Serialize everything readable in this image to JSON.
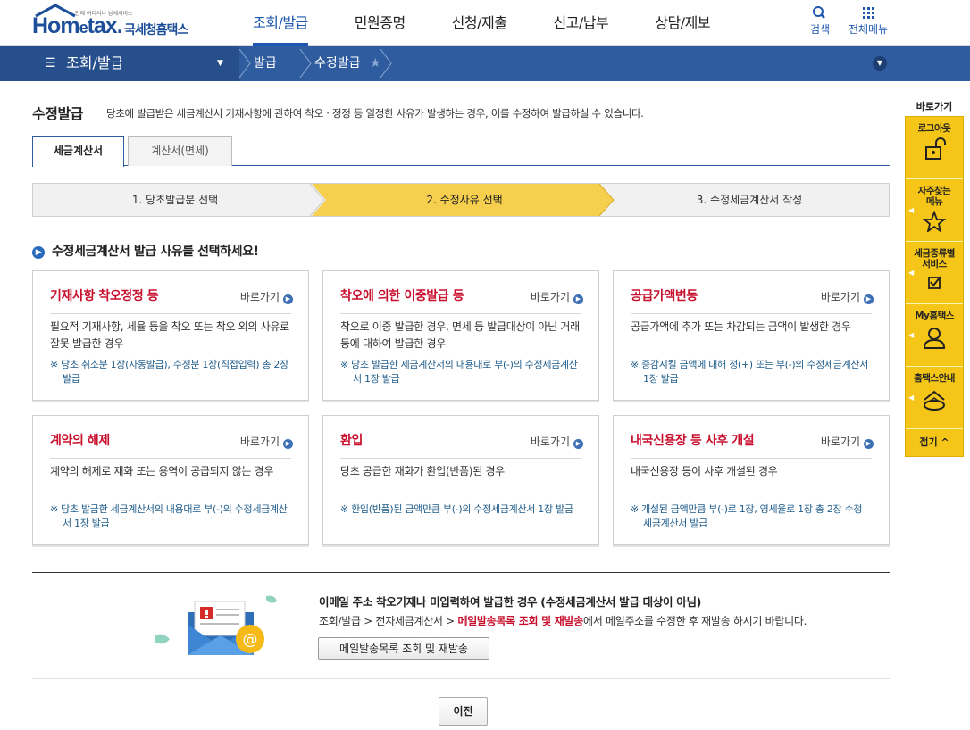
{
  "header": {
    "logo_sub": "언제 어디서나 납세서비스",
    "logo_word_1": "Hom",
    "logo_word_e": "e",
    "logo_word_2": "tax.",
    "logo_kor": "국세청홈택스",
    "nav": [
      "조회/발급",
      "민원증명",
      "신청/제출",
      "신고/납부",
      "상담/제보"
    ],
    "active_nav": "조회/발급",
    "search_label": "검색",
    "menu_label": "전체메뉴"
  },
  "location": {
    "main": "조회/발급",
    "crumb_1": "발급",
    "crumb_2": "수정발급"
  },
  "page": {
    "title": "수정발급",
    "description": "당초에 발급받은 세금계산서 기재사항에 관하여 착오 · 정정 등 일정한 사유가 발생하는 경우, 이를 수정하여 발급하실 수 있습니다."
  },
  "tabs": [
    "세금계산서",
    "계산서(면세)"
  ],
  "steps": [
    "1. 당초발급분 선택",
    "2. 수정사유 선택",
    "3. 수정세금계산서 작성"
  ],
  "section_heading": "수정세금계산서 발급 사유를 선택하세요!",
  "go_label": "바로가기",
  "cards": [
    {
      "title": "기재사항 착오정정 등",
      "desc": "필요적 기재사항, 세율 등을 착오 또는 착오 외의 사유로 잘못 발급한 경우",
      "note": "※ 당초 취소분 1장(자동발급), 수정분 1장(직접입력) 총 2장 발급"
    },
    {
      "title": "착오에 의한 이중발급 등",
      "desc": "착오로 이중 발급한 경우, 면세 등 발급대상이 아닌 거래 등에 대하여 발급한 경우",
      "note": "※ 당초 발급한 세금계산서의 내용대로 부(-)의 수정세금계산서 1장 발급"
    },
    {
      "title": "공급가액변동",
      "desc": "공급가액에 추가 또는 차감되는 금액이 발생한 경우",
      "note": "※ 증감시킬 금액에 대해 정(+) 또는 부(-)의 수정세금계산서 1장 발급"
    },
    {
      "title": "계약의 해제",
      "desc": "계약의 해제로 재화 또는 용역이 공급되지 않는 경우",
      "note": "※ 당초 발급한 세금계산서의 내용대로 부(-)의 수정세금계산서 1장 발급"
    },
    {
      "title": "환입",
      "desc": "당초 공급한 재화가 환입(반품)된 경우",
      "note": "※ 환입(반품)된 금액만큼 부(-)의 수정세금계산서 1장 발급"
    },
    {
      "title": "내국신용장 등 사후 개설",
      "desc": "내국신용장 등이 사후 개설된 경우",
      "note": "※ 개설된 금액만큼 부(-)로 1장, 영세율로 1장 총 2장 수정세금계산서 발급"
    }
  ],
  "mail": {
    "title": "이메일 주소 착오기재나 미입력하여 발급한 경우 (수정세금계산서 발급 대상이 아님)",
    "path_prefix": "조회/발급 > 전자세금계산서 > ",
    "path_highlight": "메일발송목록 조회 및 재발송",
    "path_suffix": "에서 메일주소를 수정한 후 재발송 하시기 바랍니다.",
    "button": "메일발송목록 조회 및 재발송"
  },
  "prev_button": "이전",
  "quick": {
    "head": "바로가기",
    "items": [
      {
        "label": "로그아웃",
        "icon": "unlock-icon"
      },
      {
        "label": "자주찾는\n메뉴",
        "icon": "star-icon"
      },
      {
        "label": "세금종류별\n서비스",
        "icon": "checkbox-icon"
      },
      {
        "label": "My홈택스",
        "icon": "user-icon"
      },
      {
        "label": "홈택스안내",
        "icon": "home-guide-icon"
      }
    ],
    "fold": "접기 ^"
  },
  "colors": {
    "brand_blue": "#1d57b0",
    "location_bar": "#2f5c9e",
    "step_active": "#f6cf4e",
    "card_title_red": "#c8102e",
    "quick_yellow": "#f5c518"
  }
}
